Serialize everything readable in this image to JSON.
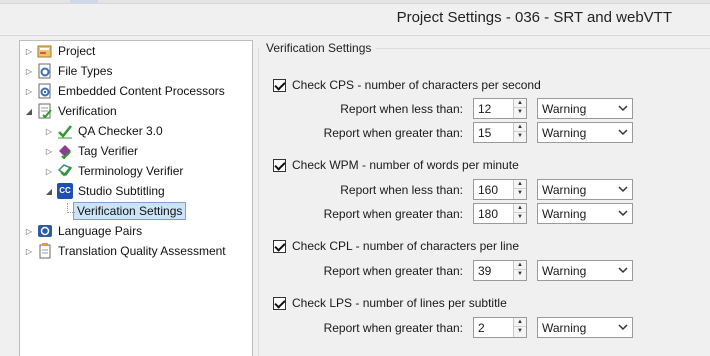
{
  "window": {
    "title": "Project Settings - 036 - SRT and webVTT"
  },
  "tree": {
    "items": [
      {
        "label": "Project",
        "icon": "project-icon",
        "expander": "▷"
      },
      {
        "label": "File Types",
        "icon": "file-types-icon",
        "expander": "▷"
      },
      {
        "label": "Embedded Content Processors",
        "icon": "processors-icon",
        "expander": "▷"
      },
      {
        "label": "Verification",
        "icon": "verification-icon",
        "expander": "◢"
      },
      {
        "label": "QA Checker 3.0",
        "icon": "qa-checker-icon",
        "expander": "▷"
      },
      {
        "label": "Tag Verifier",
        "icon": "tag-verifier-icon",
        "expander": "▷"
      },
      {
        "label": "Terminology Verifier",
        "icon": "terminology-verifier-icon",
        "expander": "▷"
      },
      {
        "label": "Studio Subtitling",
        "icon": "studio-subtitling-icon",
        "expander": "◢"
      },
      {
        "label": "Verification Settings",
        "icon": "",
        "expander": ""
      },
      {
        "label": "Language Pairs",
        "icon": "language-pairs-icon",
        "expander": "▷"
      },
      {
        "label": "Translation Quality Assessment",
        "icon": "tqa-icon",
        "expander": "▷"
      }
    ],
    "subtitle_icon_text": "CC"
  },
  "settings": {
    "group_title": "Verification Settings",
    "cps": {
      "label": "Check CPS - number of characters per second",
      "checked": true,
      "less_label": "Report when less than:",
      "less_value": "12",
      "less_level": "Warning",
      "greater_label": "Report when greater than:",
      "greater_value": "15",
      "greater_level": "Warning"
    },
    "wpm": {
      "label": "Check WPM - number of words per minute",
      "checked": true,
      "less_label": "Report when less than:",
      "less_value": "160",
      "less_level": "Warning",
      "greater_label": "Report when greater than:",
      "greater_value": "180",
      "greater_level": "Warning"
    },
    "cpl": {
      "label": "Check CPL - number of characters per line",
      "checked": true,
      "greater_label": "Report when greater than:",
      "greater_value": "39",
      "greater_level": "Warning"
    },
    "lps": {
      "label": "Check LPS - number of lines per subtitle",
      "checked": true,
      "greater_label": "Report when greater than:",
      "greater_value": "2",
      "greater_level": "Warning"
    }
  }
}
